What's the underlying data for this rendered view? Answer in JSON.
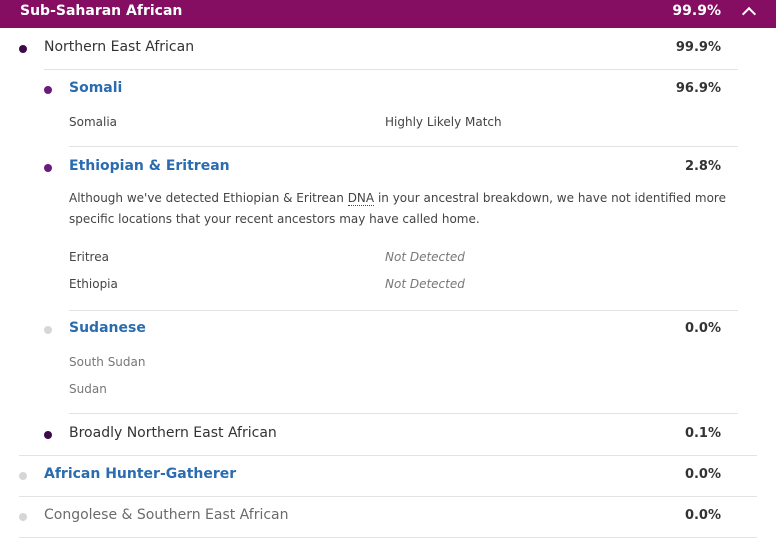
{
  "header": {
    "title": "Sub-Saharan African",
    "percent": "99.9%"
  },
  "region": {
    "label": "Northern East African",
    "percent": "99.9%"
  },
  "somali": {
    "label": "Somali",
    "percent": "96.9%",
    "location": "Somalia",
    "match": "Highly Likely Match"
  },
  "ethiopian": {
    "label": "Ethiopian & Eritrean",
    "percent": "2.8%",
    "desc_before": "Although we've detected Ethiopian & Eritrean ",
    "desc_dna": "DNA",
    "desc_after": " in your ancestral breakdown, we have not identified more specific locations that your recent ancestors may have called home.",
    "locations": [
      {
        "name": "Eritrea",
        "status": "Not Detected"
      },
      {
        "name": "Ethiopia",
        "status": "Not Detected"
      }
    ]
  },
  "sudanese": {
    "label": "Sudanese",
    "percent": "0.0%",
    "locations": [
      "South Sudan",
      "Sudan"
    ]
  },
  "broad_nea": {
    "label": "Broadly Northern East African",
    "percent": "0.1%"
  },
  "hunter": {
    "label": "African Hunter-Gatherer",
    "percent": "0.0%"
  },
  "congolese": {
    "label": "Congolese & Southern East African",
    "percent": "0.0%"
  },
  "colors": {
    "header_bg": "#850d62",
    "link": "#2b6cb0",
    "dot_dark": "#3c0b4a",
    "dot_purple": "#6a1b7e",
    "dot_grey": "#d6d6d6"
  }
}
